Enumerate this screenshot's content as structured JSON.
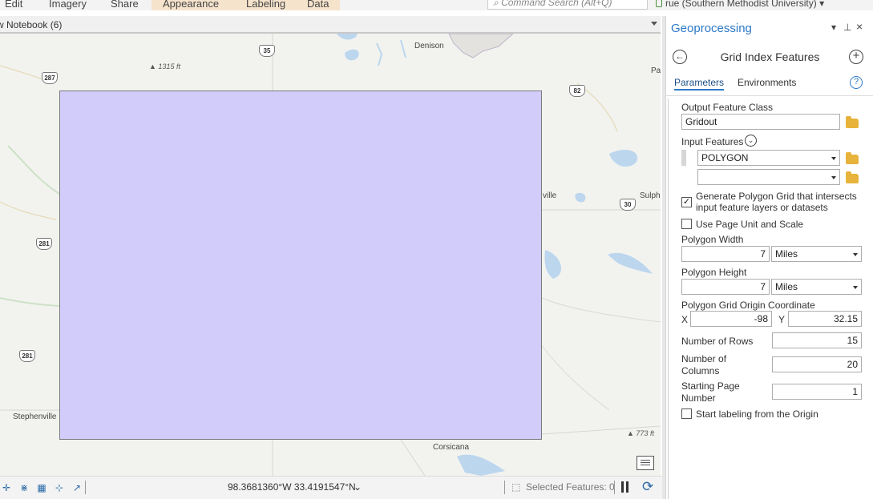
{
  "ribbon": {
    "tabs": [
      "Edit",
      "Imagery",
      "Share",
      "Appearance",
      "Labeling",
      "Data"
    ],
    "command_search_placeholder": "Command Search (Alt+Q)",
    "user": "rue (Southern Methodist University)"
  },
  "map_view": {
    "title": "w Notebook (6)",
    "places": [
      "Denison",
      "Stephenville",
      "Corsicana",
      "ville",
      "Sulph",
      "Pa"
    ],
    "elevations": [
      "1315 ft",
      "773 ft"
    ],
    "route_shields": [
      "35",
      "287",
      "82",
      "30",
      "281",
      "281"
    ]
  },
  "status_bar": {
    "coordinates": "98.3681360°W 33.4191547°N",
    "selected_features": "Selected Features: 0"
  },
  "geoprocessing": {
    "pane_title": "Geoprocessing",
    "pane_controls": [
      "▾",
      "⊥",
      "×"
    ],
    "tool_title": "Grid Index Features",
    "tabs": [
      "Parameters",
      "Environments"
    ],
    "active_tab": "Parameters",
    "output_feature_class": {
      "label": "Output Feature Class",
      "value": "Gridout"
    },
    "input_features": {
      "label": "Input Features",
      "values": [
        "POLYGON",
        ""
      ]
    },
    "generate_polygon_grid": {
      "label": "Generate Polygon Grid that intersects input feature layers or datasets",
      "checked": true,
      "mark": "✓"
    },
    "use_page_unit": {
      "label": "Use Page Unit and Scale",
      "checked": false
    },
    "polygon_width": {
      "label": "Polygon Width",
      "value": "7",
      "unit": "Miles"
    },
    "polygon_height": {
      "label": "Polygon Height",
      "value": "7",
      "unit": "Miles"
    },
    "origin": {
      "label": "Polygon Grid Origin Coordinate",
      "x_label": "X",
      "x": "-98",
      "y_label": "Y",
      "y": "32.15"
    },
    "rows": {
      "label": "Number of Rows",
      "value": "15"
    },
    "columns": {
      "label": "Number of Columns",
      "value": "20"
    },
    "starting_page": {
      "label": "Starting Page Number",
      "value": "1"
    },
    "label_from_origin": {
      "label": "Start labeling from the Origin",
      "checked": false
    }
  },
  "colors": {
    "accent": "#2d79c7",
    "polygon_fill": "#d2ccfb",
    "folder": "#e8b33a"
  }
}
